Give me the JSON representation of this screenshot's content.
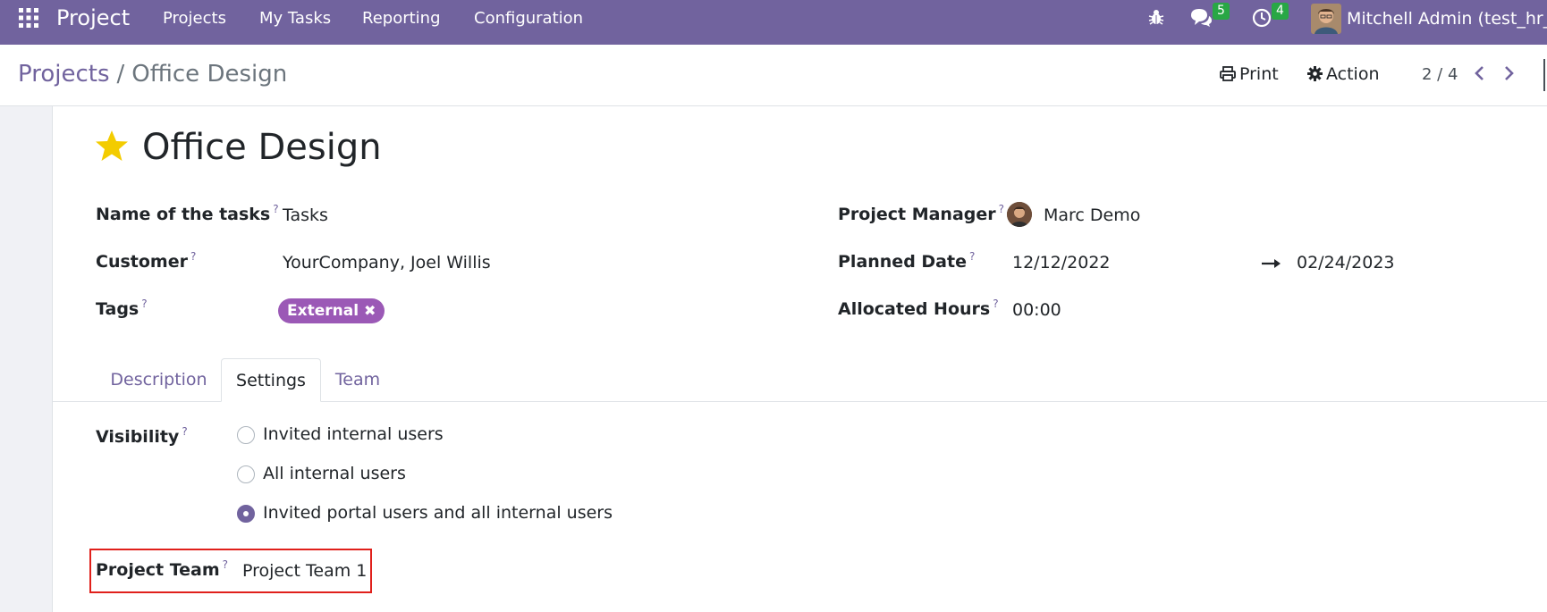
{
  "navbar": {
    "app_name": "Project",
    "menu": [
      "Projects",
      "My Tasks",
      "Reporting",
      "Configuration"
    ],
    "messages_count": "5",
    "activities_count": "4",
    "user_name": "Mitchell Admin (test_hr_c",
    "icons": {
      "apps": "apps-grid-icon",
      "debug": "bug-icon",
      "messages": "chat-bubbles-icon",
      "activities": "clock-icon"
    }
  },
  "control_panel": {
    "breadcrumb_parent": "Projects",
    "breadcrumb_separator": "/",
    "breadcrumb_current": "Office Design",
    "print_label": "Print",
    "action_label": "Action",
    "pager": "2 / 4"
  },
  "form": {
    "title": "Office Design",
    "favorite": true,
    "help_marker": "?",
    "left_fields": {
      "tasks_label": "Name of the tasks",
      "tasks_value": "Tasks",
      "customer_label": "Customer",
      "customer_value": "YourCompany, Joel Willis",
      "tags_label": "Tags",
      "tags": [
        "External"
      ]
    },
    "right_fields": {
      "manager_label": "Project Manager",
      "manager_value": "Marc Demo",
      "planned_label": "Planned Date",
      "planned_start": "12/12/2022",
      "planned_end": "02/24/2023",
      "hours_label": "Allocated Hours",
      "hours_value": "00:00"
    },
    "tabs": [
      "Description",
      "Settings",
      "Team"
    ],
    "active_tab": "Settings",
    "settings": {
      "visibility_label": "Visibility",
      "visibility_options": [
        "Invited internal users",
        "All internal users",
        "Invited portal users and all internal users"
      ],
      "visibility_selected": "Invited portal users and all internal users",
      "team_label": "Project Team",
      "team_value": "Project Team 1"
    }
  },
  "colors": {
    "brand": "#71639e",
    "tag": "#9b59b6",
    "badge": "#28a745",
    "highlight": "#e0201b",
    "star": "#f3cc00"
  }
}
